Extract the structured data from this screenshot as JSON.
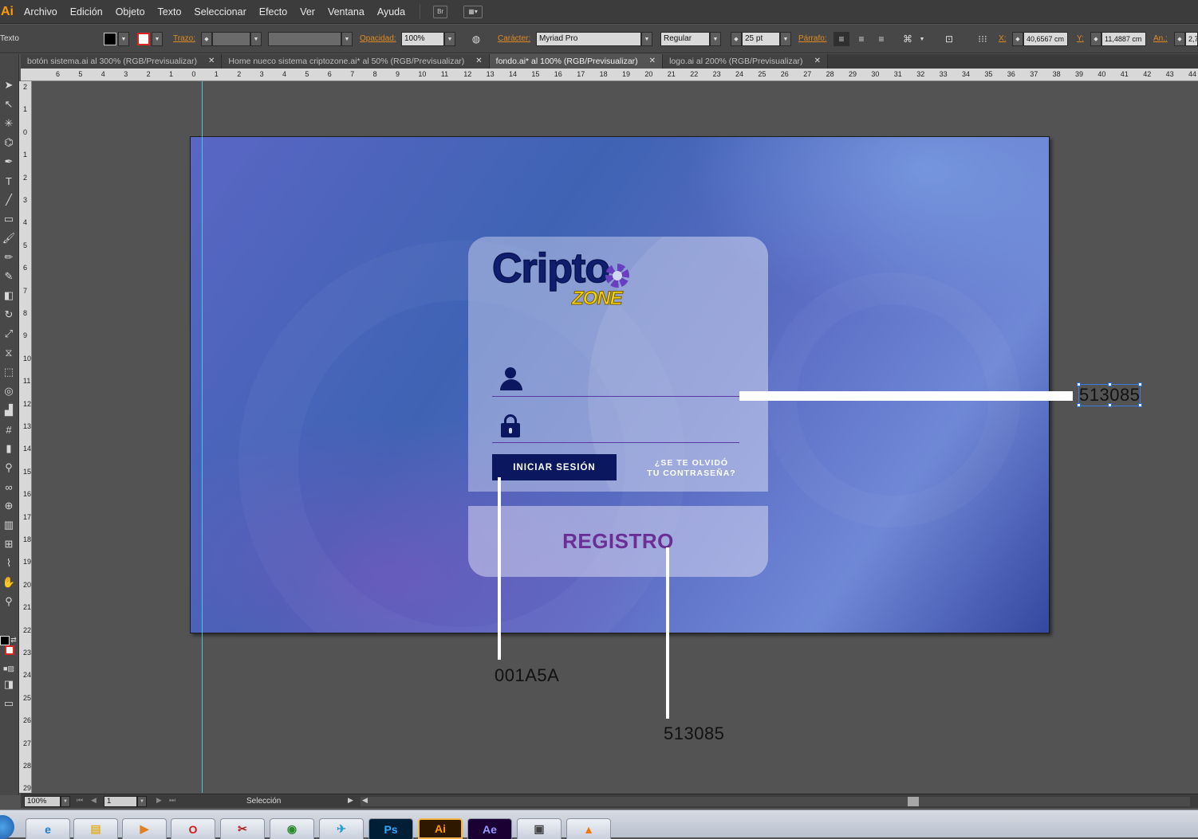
{
  "app": {
    "logo_text": "Ai"
  },
  "menu": {
    "items": [
      "Archivo",
      "Edición",
      "Objeto",
      "Texto",
      "Seleccionar",
      "Efecto",
      "Ver",
      "Ventana",
      "Ayuda"
    ],
    "bridge_label": "Br"
  },
  "controlbar": {
    "tool_name": "Texto",
    "stroke_label": "Trazo:",
    "opacity_label": "Opacidad:",
    "opacity_value": "100%",
    "character_label": "Carácter:",
    "font_family": "Myriad Pro",
    "font_style": "Regular",
    "font_size": "25 pt",
    "paragraph_label": "Párrafo:",
    "x_label": "X:",
    "x_value": "40,6567 cm",
    "y_label": "Y:",
    "y_value": "11,4887 cm",
    "width_label": "An.:",
    "width_value": "2,7"
  },
  "tabs": [
    {
      "label": "botón sistema.ai al 300% (RGB/Previsualizar)",
      "active": false
    },
    {
      "label": "Home nueco sistema criptozone.ai* al 50% (RGB/Previsualizar)",
      "active": false
    },
    {
      "label": "fondo.ai* al 100% (RGB/Previsualizar)",
      "active": true
    },
    {
      "label": "logo.ai al 200% (RGB/Previsualizar)",
      "active": false
    }
  ],
  "ruler": {
    "h_ticks": [
      "6",
      "5",
      "4",
      "3",
      "2",
      "1",
      "0",
      "1",
      "2",
      "3",
      "4",
      "5",
      "6",
      "7",
      "8",
      "9",
      "10",
      "11",
      "12",
      "13",
      "14",
      "15",
      "16",
      "17",
      "18",
      "19",
      "20",
      "21",
      "22",
      "23",
      "24",
      "25",
      "26",
      "27",
      "28",
      "29",
      "30",
      "31",
      "32",
      "33",
      "34",
      "35",
      "36",
      "37",
      "38",
      "39",
      "40",
      "41",
      "42",
      "43",
      "44"
    ],
    "v_ticks": [
      "2",
      "1",
      "0",
      "1",
      "2",
      "3",
      "4",
      "5",
      "6",
      "7",
      "8",
      "9",
      "10",
      "11",
      "12",
      "13",
      "14",
      "15",
      "16",
      "17",
      "18",
      "19",
      "20",
      "21",
      "22",
      "23",
      "24",
      "25",
      "26",
      "27",
      "28",
      "29"
    ]
  },
  "artwork": {
    "logo_main": "Cripto",
    "logo_sub": "ZONE",
    "login_button": "INICIAR SESIÓN",
    "forgot_line1": "¿SE TE OLVIDÓ",
    "forgot_line2": "TU CONTRASEÑA?",
    "register": "REGISTRO"
  },
  "annotations": {
    "field_color": "513085",
    "button_color": "001A5A",
    "register_color": "513085"
  },
  "colors": {
    "button_bg": "#001A5A",
    "field_line": "#513085",
    "register_text": "#513085"
  },
  "statusbar": {
    "zoom": "100%",
    "artboard_num": "1",
    "status_text": "Selección"
  },
  "taskbar": {
    "apps": [
      "start-orb",
      "internet-explorer",
      "file-explorer",
      "media-player",
      "opera",
      "app-red",
      "chrome",
      "telegram",
      "Ps",
      "Ai",
      "Ae",
      "photo-app",
      "vlc"
    ]
  }
}
